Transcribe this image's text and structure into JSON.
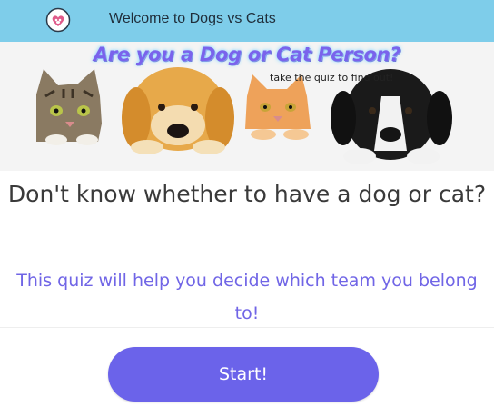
{
  "header": {
    "title": "Welcome to Dogs vs Cats",
    "logo_icon": "paw-heart-icon",
    "background": "#7ecdea"
  },
  "banner": {
    "headline": "Are you a Dog or Cat Person?",
    "tagline": "take the quiz to find out!",
    "image_icons": [
      "tabby-cat-icon",
      "golden-retriever-icon",
      "orange-cat-icon",
      "black-white-dog-icon"
    ]
  },
  "main": {
    "question": "Don't know whether to have a dog or cat?",
    "subtext": "This quiz will help you decide which team you belong to!",
    "start_label": "Start!"
  },
  "colors": {
    "accent": "#6b63ea",
    "subtext": "#7065e6",
    "heading": "#3a3a3a"
  }
}
